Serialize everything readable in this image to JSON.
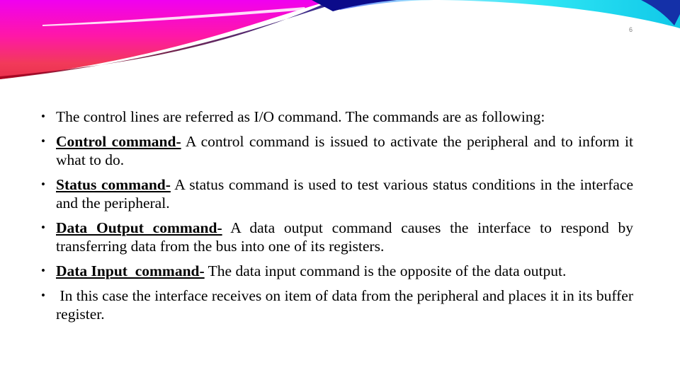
{
  "slide": {
    "number": "6",
    "banner": {
      "colors": {
        "magenta": "#ee00ee",
        "pink": "#ff1d8d",
        "red": "#e8304a",
        "dark_red": "#8a0012",
        "navy": "#0b0b8a",
        "cyan": "#1de6f0",
        "blue": "#1430a8"
      }
    },
    "bullets": [
      {
        "term": "",
        "text": "The control lines are referred as I/O command. The  commands are as following:"
      },
      {
        "term": "Control command-",
        "text": " A control command is issued to activate the peripheral and to inform it what to do."
      },
      {
        "term": "Status command-",
        "text": " A status command is used to test various status conditions in the interface and the peripheral."
      },
      {
        "term": "Data Output command-",
        "text": " A data output command causes the interface to respond by transferring data from the bus into one of its registers."
      },
      {
        "term": "Data Input  command-",
        "text": " The data input command is the opposite of the data output."
      },
      {
        "term": "",
        "text": " In this case the interface receives on item of data from the peripheral and places it in its buffer register."
      }
    ],
    "bullet_glyph": "•"
  }
}
